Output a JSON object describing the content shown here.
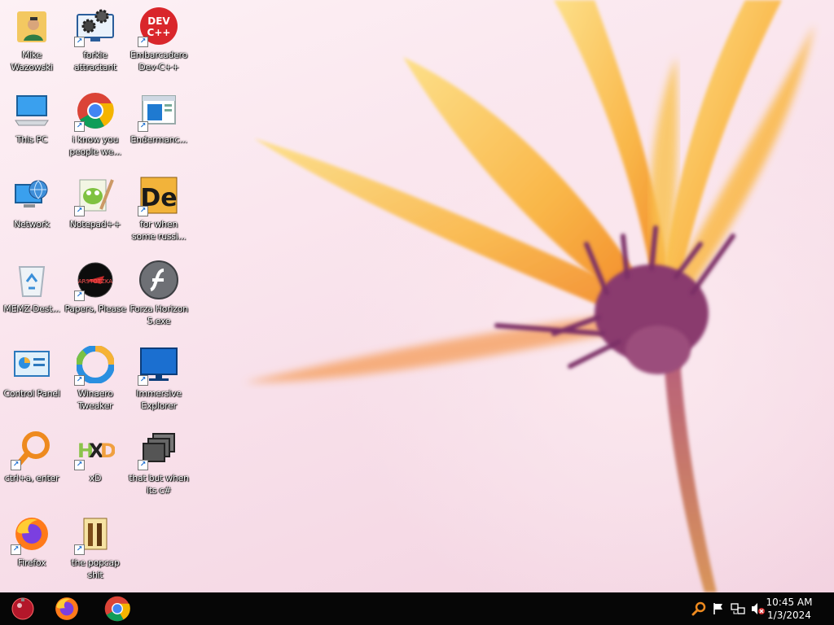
{
  "desktop": {
    "icons": [
      {
        "label": "Mike\nWazowski",
        "icon": "user-folder-icon"
      },
      {
        "label": "forkie\nattractant",
        "icon": "gear-monitor-icon"
      },
      {
        "label": "Embarcadero\nDev-C++",
        "icon": "devcpp-icon"
      },
      {
        "label": "This PC",
        "icon": "computer-icon"
      },
      {
        "label": "i know you\npeople we...",
        "icon": "chrome-icon"
      },
      {
        "label": "Endermanc...",
        "icon": "window-app-icon"
      },
      {
        "label": "Network",
        "icon": "network-globe-icon"
      },
      {
        "label": "Notepad++",
        "icon": "notepad-plus-plus-icon"
      },
      {
        "label": "for when\nsome russi...",
        "icon": "de-app-icon"
      },
      {
        "label": "MEMZ-Dest...",
        "icon": "recycle-bin-icon"
      },
      {
        "label": "Papers, Please",
        "icon": "papers-please-icon"
      },
      {
        "label": "Forza Horizon\n5.exe",
        "icon": "flash-icon"
      },
      {
        "label": "Control Panel",
        "icon": "control-panel-icon"
      },
      {
        "label": "Winaero\nTweaker",
        "icon": "winaero-icon"
      },
      {
        "label": "Immersive\nExplorer",
        "icon": "monitor-icon"
      },
      {
        "label": "ctrl+a, enter",
        "icon": "magnifier-icon"
      },
      {
        "label": "xD",
        "icon": "hxd-icon"
      },
      {
        "label": "that but when\nits c#",
        "icon": "stacked-windows-icon"
      },
      {
        "label": "Firefox",
        "icon": "firefox-icon"
      },
      {
        "label": "the popcap\nshit",
        "icon": "popcap-icon"
      }
    ]
  },
  "taskbar": {
    "start_icon": "start-orb-icon",
    "pinned": [
      {
        "name": "firefox",
        "icon": "firefox-icon"
      },
      {
        "name": "chrome",
        "icon": "chrome-icon"
      }
    ],
    "tray": [
      "search-tray-icon",
      "flag-icon",
      "network-tray-icon",
      "volume-muted-icon"
    ],
    "time": "10:45 AM",
    "date": "1/3/2024"
  },
  "colors": {
    "taskbar": "#060606",
    "wallpaper_pink": "#f9e3ec",
    "petal_orange": "#f7a93a",
    "flower_center": "#8a3a6e"
  }
}
